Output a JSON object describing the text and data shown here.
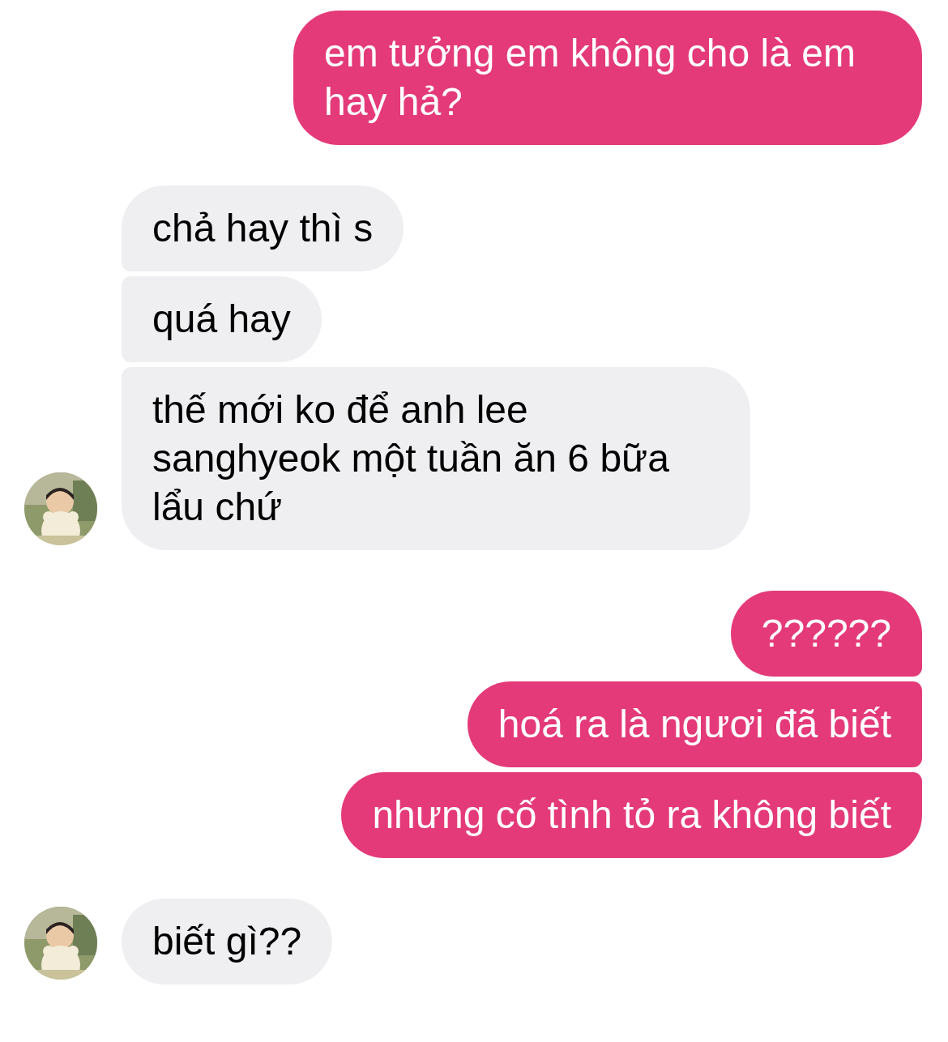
{
  "messages": [
    {
      "kind": "outgoing",
      "bubbles": [
        "em tưởng em không cho là em hay hả?"
      ]
    },
    {
      "kind": "incoming",
      "bubbles": [
        "chả hay thì s",
        "quá hay",
        "thế mới ko để anh lee sanghyeok một tuần ăn 6 bữa lẩu chứ"
      ]
    },
    {
      "kind": "outgoing",
      "bubbles": [
        "??????",
        "hoá ra là ngươi đã biết",
        "nhưng cố tình tỏ ra không biết"
      ]
    },
    {
      "kind": "incoming",
      "bubbles": [
        "biết gì??"
      ]
    }
  ]
}
